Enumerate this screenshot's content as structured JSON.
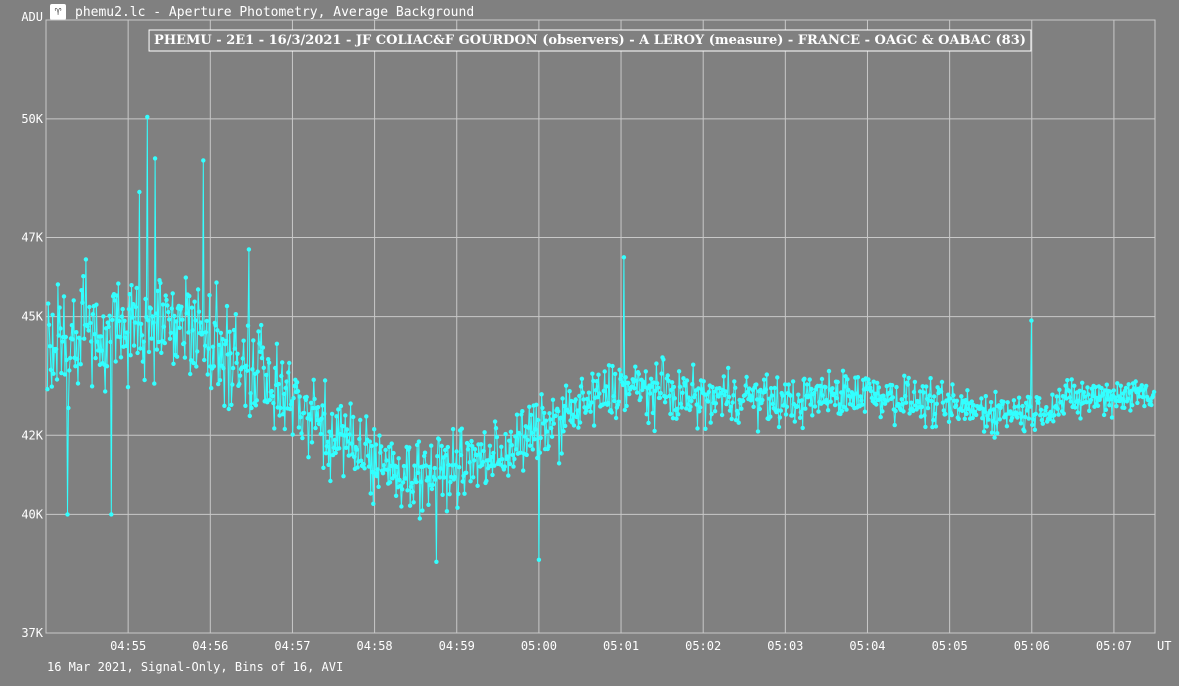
{
  "window": {
    "title": "phemu2.lc - Aperture Photometry, Average Background",
    "icon": "lightcurve-app-icon"
  },
  "footer": {
    "text": "16 Mar 2021, Signal-Only, Bins of 16, AVI"
  },
  "colors": {
    "background": "#808080",
    "grid": "#c8c8c8",
    "series": "#33ffff",
    "text": "#ffffff"
  },
  "chart_data": {
    "type": "line",
    "title": "PHEMU - 2E1 - 16/3/2021 - JF COLIAC&F GOURDON (observers) - A LEROY (measure) - FRANCE - OAGC & OABAC (83)",
    "ylabel": "ADU",
    "xlabel": "UT",
    "y_ticks": [
      "37K",
      "40K",
      "42K",
      "45K",
      "47K",
      "50K"
    ],
    "x_ticks": [
      "04:55",
      "04:56",
      "04:57",
      "04:58",
      "04:59",
      "05:00",
      "05:01",
      "05:02",
      "05:03",
      "05:04",
      "05:05",
      "05:06",
      "05:07"
    ],
    "ylim": [
      37000,
      52500
    ],
    "xlim": [
      "04:54:00",
      "05:07:30"
    ],
    "grid": true,
    "series": [
      {
        "color": "#33ffff",
        "x_step_seconds": 0.64,
        "segment_means": [
          [
            "04:54:00",
            44300
          ],
          [
            "04:55:00",
            44700
          ],
          [
            "04:55:30",
            45000
          ],
          [
            "04:56:00",
            44300
          ],
          [
            "04:56:30",
            43800
          ],
          [
            "04:57:00",
            42900
          ],
          [
            "04:57:30",
            42100
          ],
          [
            "04:58:00",
            41300
          ],
          [
            "04:58:30",
            41000
          ],
          [
            "04:59:00",
            41200
          ],
          [
            "04:59:30",
            41500
          ],
          [
            "05:00:00",
            42100
          ],
          [
            "05:00:30",
            42700
          ],
          [
            "05:01:00",
            43200
          ],
          [
            "05:01:30",
            43100
          ],
          [
            "05:02:00",
            42900
          ],
          [
            "05:02:30",
            43000
          ],
          [
            "05:03:00",
            42800
          ],
          [
            "05:03:30",
            43000
          ],
          [
            "05:04:00",
            43100
          ],
          [
            "05:04:30",
            42900
          ],
          [
            "05:05:00",
            42700
          ],
          [
            "05:05:30",
            42600
          ],
          [
            "05:06:00",
            42600
          ],
          [
            "05:06:30",
            42900
          ],
          [
            "05:07:00",
            43000
          ],
          [
            "05:07:30",
            43100
          ]
        ],
        "segment_spread": [
          [
            "04:54:00",
            2300
          ],
          [
            "04:56:00",
            2000
          ],
          [
            "04:57:00",
            1500
          ],
          [
            "04:58:30",
            1300
          ],
          [
            "05:00:00",
            1200
          ],
          [
            "05:01:00",
            1100
          ],
          [
            "05:03:00",
            900
          ],
          [
            "05:05:00",
            800
          ],
          [
            "05:07:30",
            700
          ]
        ],
        "extremes": [
          [
            "04:55:14",
            50050
          ],
          [
            "04:54:48",
            48900
          ],
          [
            "04:55:55",
            48950
          ],
          [
            "04:55:08",
            48150
          ],
          [
            "04:55:20",
            49000
          ],
          [
            "04:54:16",
            40000
          ],
          [
            "04:54:48",
            40000
          ],
          [
            "04:58:45",
            38800
          ],
          [
            "05:00:00",
            38850
          ],
          [
            "05:01:02",
            46500
          ],
          [
            "04:56:28",
            46700
          ],
          [
            "05:06:00",
            44900
          ]
        ]
      }
    ]
  }
}
